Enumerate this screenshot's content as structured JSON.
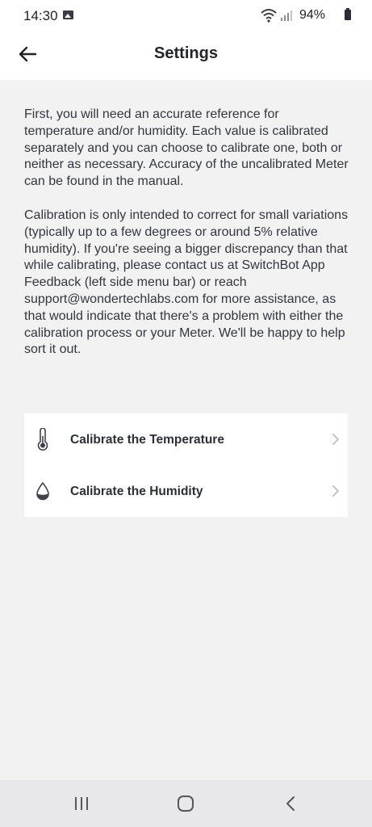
{
  "status_bar": {
    "time": "14:30",
    "battery": "94%"
  },
  "header": {
    "title": "Settings"
  },
  "content": {
    "paragraph_1": "First, you will need an accurate reference for temperature and/or humidity. Each value is calibrated separately and you can choose to calibrate one, both or neither as necessary. Accuracy of the uncalibrated Meter can be found in the manual.",
    "paragraph_2": "Calibration is only intended to correct for small variations (typically up to a few degrees or around 5% relative humidity). If you're seeing a bigger discrepancy than that while calibrating, please contact us at SwitchBot App Feedback (left side menu bar) or reach support@wondertechlabs.com for more assistance, as that would indicate that there's a problem with either the calibration process or your Meter. We'll be happy to help sort it out."
  },
  "options": [
    {
      "label": "Calibrate the Temperature",
      "icon": "thermometer-icon"
    },
    {
      "label": "Calibrate the Humidity",
      "icon": "droplet-icon"
    }
  ],
  "nav_bar": {
    "buttons": [
      "recents",
      "home",
      "back"
    ]
  },
  "colors": {
    "background": "#f2f2f3",
    "card": "#ffffff",
    "text": "#33363d",
    "chevron": "#b9bcc2"
  }
}
